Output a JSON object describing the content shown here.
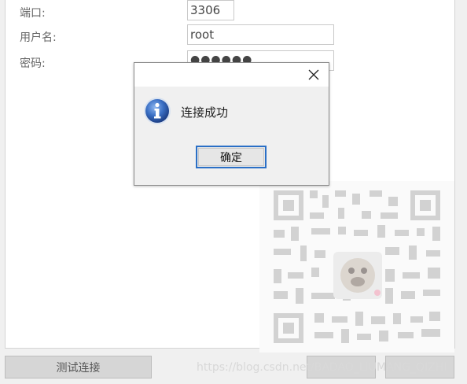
{
  "form": {
    "port_label": "端口:",
    "port_value": "3306",
    "username_label": "用户名:",
    "username_value": "root",
    "password_label": "密码:",
    "password_dots": "●●●●●●"
  },
  "bottom_bar": {
    "test_connection_label": "测试连接"
  },
  "dialog": {
    "message": "连接成功",
    "ok_label": "确定"
  },
  "watermark": {
    "text": "https://blog.csdn.net/BADAO_LIUMANG_QIZHI"
  },
  "colors": {
    "dialog_ok_border": "#2a6fc6",
    "info_icon_blue": "#2456a8"
  }
}
